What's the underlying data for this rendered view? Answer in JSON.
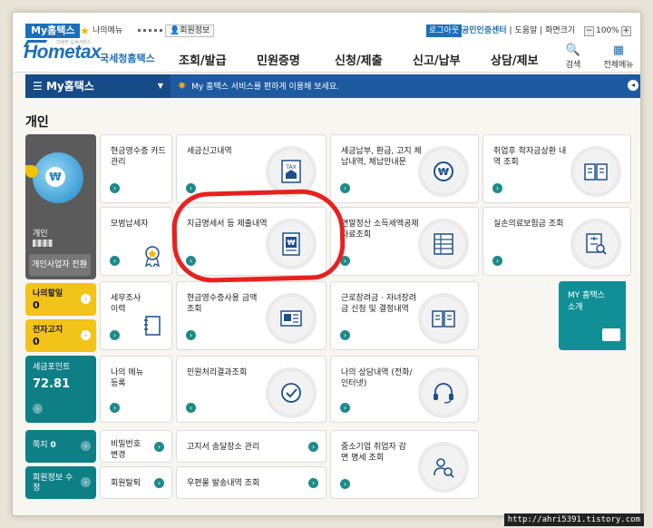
{
  "util": {
    "my_tab": "My홈택스",
    "my_menu": "나의메뉴",
    "member_info": "회원정보",
    "logout": "로그아웃",
    "cert_center": "공인인증센터",
    "help": "도움말",
    "site_map": "화면크기",
    "zoom": "100%"
  },
  "header": {
    "logo_text": "Hometax",
    "logo_sub": "국세청홈택스",
    "slogan": "안녕한 납세서비스",
    "menu": [
      "조회/발급",
      "민원증명",
      "신청/제출",
      "신고/납부",
      "상담/제보"
    ],
    "search": "검색",
    "all_menu": "전체메뉴"
  },
  "bluebar": {
    "my": "My홈택스",
    "message": "My 홈택스 서비스를 편하게 이용해 보세요."
  },
  "section_title": "개인",
  "profile": {
    "name_label": "개인",
    "convert": "개인사업자 전환"
  },
  "side": {
    "tax_info_label": "나의할일",
    "tax_info_value": "0",
    "notice_label": "전자고지",
    "notice_value": "0",
    "points_label": "세금포인트",
    "points_value": "72.81",
    "note_label": "쪽지",
    "note_value": "0",
    "member_edit": "회원정보 수정"
  },
  "tiles": [
    {
      "label": "현금영수증 카드관리"
    },
    {
      "label": "세금신고내역"
    },
    {
      "label": "세금납부, 환급, 고지 체납내역, 체납안내문"
    },
    {
      "label": "취업후 학자금상환 내역 조회"
    },
    {
      "label": "모범납세자"
    },
    {
      "label": "지급명세서 등 제출내역"
    },
    {
      "label": "연말정산 소득세액공제 자료조회"
    },
    {
      "label": "실손의료보험금 조회"
    },
    {
      "label": "세무조사 이력"
    },
    {
      "label": "현금영수증사용 금액조회"
    },
    {
      "label": "근로장려금 · 자녀장려금 신청 및 결정내역"
    },
    {
      "label": "나의 메뉴 등록"
    },
    {
      "label": "민원처리결과조회"
    },
    {
      "label": "나의 상담내역 (전화/인터넷)"
    },
    {
      "label": "비밀번호 변경"
    },
    {
      "label": "고지서 송달장소 관리"
    },
    {
      "label": "중소기업 취업자 감면 명세 조회"
    },
    {
      "label": "회원탈퇴"
    },
    {
      "label": "우편물 발송내역 조회"
    }
  ],
  "my_hometax_intro": "MY 홈택스 소개",
  "credit": "http://ahri5391.tistory.com"
}
